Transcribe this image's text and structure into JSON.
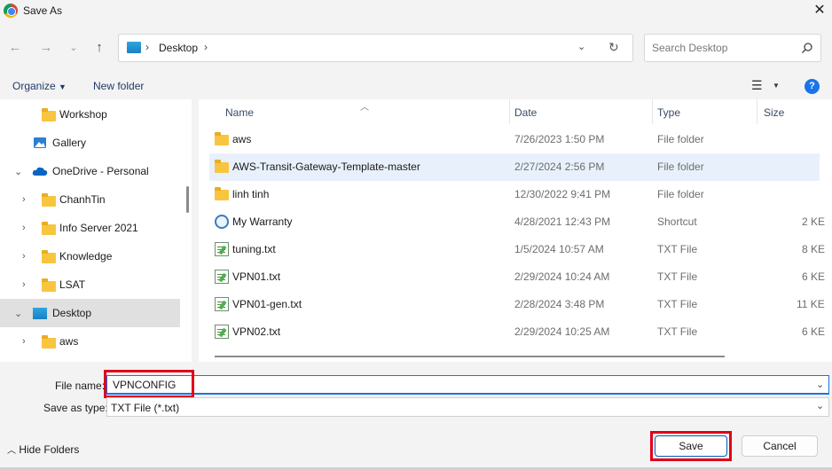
{
  "window": {
    "title": "Save As",
    "close_icon": "close-icon"
  },
  "nav": {
    "back_icon": "arrow-left-icon",
    "forward_icon": "arrow-right-icon",
    "recent_icon": "chevron-down-icon",
    "up_icon": "arrow-up-icon",
    "address": {
      "icon": "desktop-icon",
      "path": "Desktop"
    },
    "search": {
      "placeholder": "Search Desktop",
      "icon": "search-icon"
    }
  },
  "toolbar": {
    "organize": "Organize",
    "new_folder": "New folder",
    "help": "?"
  },
  "tree": [
    {
      "label": "Workshop",
      "icon": "folder-icon",
      "chevron": ""
    },
    {
      "label": "Gallery",
      "icon": "gallery-icon",
      "chevron": ""
    },
    {
      "label": "OneDrive - Personal",
      "icon": "cloud-icon",
      "chevron": "down"
    },
    {
      "label": "ChanhTin",
      "icon": "folder-icon",
      "chevron": "right"
    },
    {
      "label": "Info Server 2021",
      "icon": "folder-icon",
      "chevron": "right"
    },
    {
      "label": "Knowledge",
      "icon": "folder-icon",
      "chevron": "right"
    },
    {
      "label": "LSAT",
      "icon": "folder-icon",
      "chevron": "right"
    },
    {
      "label": "Desktop",
      "icon": "desktop-icon",
      "chevron": "down",
      "selected": true
    },
    {
      "label": "aws",
      "icon": "folder-icon",
      "chevron": "right"
    }
  ],
  "columns": {
    "name": "Name",
    "date": "Date",
    "type": "Type",
    "size": "Size"
  },
  "files": [
    {
      "name": "aws",
      "date": "7/26/2023 1:50 PM",
      "type": "File folder",
      "size": "",
      "icon": "folder-icon"
    },
    {
      "name": "AWS-Transit-Gateway-Template-master",
      "date": "2/27/2024 2:56 PM",
      "type": "File folder",
      "size": "",
      "icon": "folder-icon"
    },
    {
      "name": "linh tinh",
      "date": "12/30/2022 9:41 PM",
      "type": "File folder",
      "size": "",
      "icon": "folder-icon"
    },
    {
      "name": "My Warranty",
      "date": "4/28/2021 12:43 PM",
      "type": "Shortcut",
      "size": "2 KE",
      "icon": "shortcut-icon"
    },
    {
      "name": "tuning.txt",
      "date": "1/5/2024 10:57 AM",
      "type": "TXT File",
      "size": "8 KE",
      "icon": "text-file-icon"
    },
    {
      "name": "VPN01.txt",
      "date": "2/29/2024 10:24 AM",
      "type": "TXT File",
      "size": "6 KE",
      "icon": "text-file-icon"
    },
    {
      "name": "VPN01-gen.txt",
      "date": "2/28/2024 3:48 PM",
      "type": "TXT File",
      "size": "11 KE",
      "icon": "text-file-icon"
    },
    {
      "name": "VPN02.txt",
      "date": "2/29/2024 10:25 AM",
      "type": "TXT File",
      "size": "6 KE",
      "icon": "text-file-icon"
    }
  ],
  "form": {
    "file_name_label": "File name:",
    "file_name_value": "VPNCONFIG",
    "save_type_label": "Save as type:",
    "save_type_value": "TXT File (*.txt)"
  },
  "footer": {
    "hide_folders": "Hide Folders",
    "save": "Save",
    "cancel": "Cancel"
  },
  "colors": {
    "accent": "#1a73e8",
    "highlight_box": "#e0001b",
    "selected_row": "#e8f1fb"
  }
}
